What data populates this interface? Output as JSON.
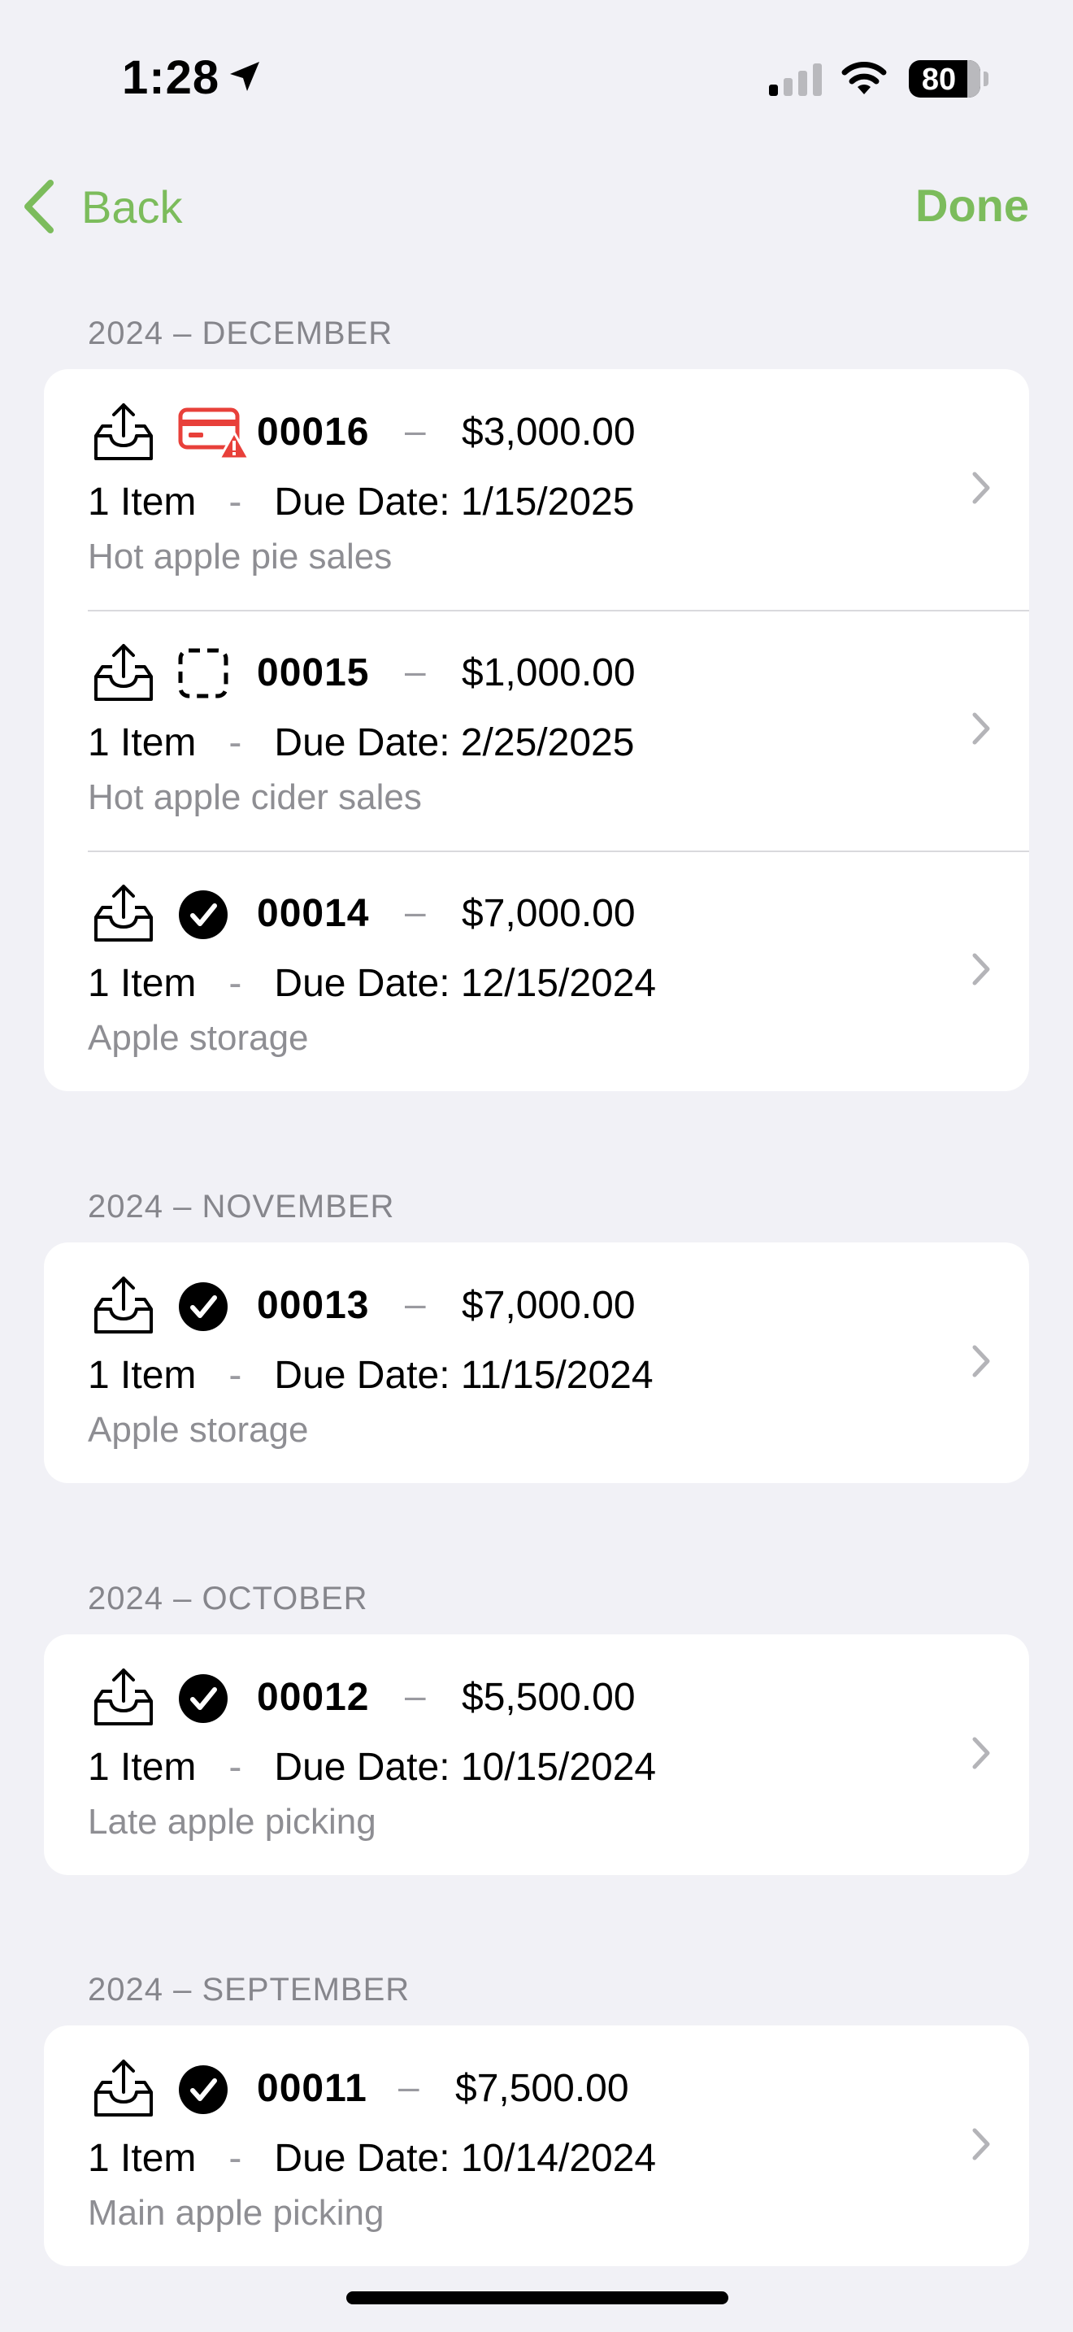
{
  "status": {
    "time": "1:28",
    "battery": "80"
  },
  "nav": {
    "back_label": "Back",
    "done_label": "Done"
  },
  "sections": [
    {
      "header": "2024 – DECEMBER",
      "rows": [
        {
          "number": "00016",
          "dash": "–",
          "amount": "$3,000.00",
          "items": "1 Item",
          "sep": "-",
          "due": "Due Date: 1/15/2025",
          "desc": "Hot apple pie sales",
          "status_icon": "payment-warning-icon"
        },
        {
          "number": "00015",
          "dash": "–",
          "amount": "$1,000.00",
          "items": "1 Item",
          "sep": "-",
          "due": "Due Date: 2/25/2025",
          "desc": "Hot apple cider sales",
          "status_icon": "draft-dashed-icon"
        },
        {
          "number": "00014",
          "dash": "–",
          "amount": "$7,000.00",
          "items": "1 Item",
          "sep": "-",
          "due": "Due Date: 12/15/2024",
          "desc": "Apple storage",
          "status_icon": "paid-checkmark-icon"
        }
      ]
    },
    {
      "header": "2024 – NOVEMBER",
      "rows": [
        {
          "number": "00013",
          "dash": "–",
          "amount": "$7,000.00",
          "items": "1 Item",
          "sep": "-",
          "due": "Due Date: 11/15/2024",
          "desc": "Apple storage",
          "status_icon": "paid-checkmark-icon"
        }
      ]
    },
    {
      "header": "2024 – OCTOBER",
      "rows": [
        {
          "number": "00012",
          "dash": "–",
          "amount": "$5,500.00",
          "items": "1 Item",
          "sep": "-",
          "due": "Due Date: 10/15/2024",
          "desc": "Late apple picking",
          "status_icon": "paid-checkmark-icon"
        }
      ]
    },
    {
      "header": "2024 – SEPTEMBER",
      "rows": [
        {
          "number": "00011",
          "dash": "–",
          "amount": "$7,500.00",
          "items": "1 Item",
          "sep": "-",
          "due": "Due Date: 10/14/2024",
          "desc": "Main apple picking",
          "status_icon": "paid-checkmark-icon"
        }
      ]
    }
  ],
  "colors": {
    "accent": "#7cbc5c",
    "warning": "#e8403a",
    "background": "#f1f1f6",
    "secondary_text": "#8e8e93"
  }
}
